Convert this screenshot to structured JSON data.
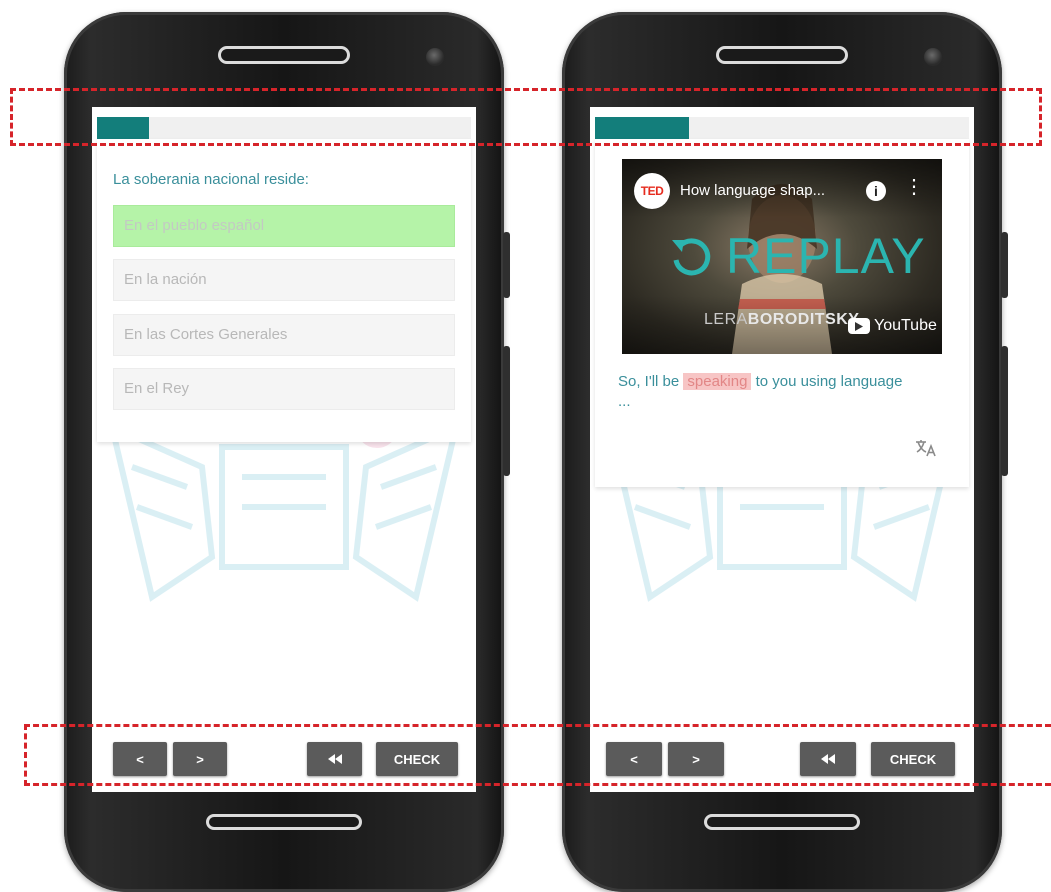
{
  "colors": {
    "progress": "#137e7b",
    "question_text": "#3a8f9b",
    "correct_option": "#b5f3a8",
    "button_bg": "#5b5b5b",
    "highlight_word": "#f7c5c5",
    "replay": "#2bb5b0",
    "dashed_box": "#d6242a"
  },
  "left_phone": {
    "progress": 0.14,
    "question": "La soberania nacional reside:",
    "options": [
      {
        "label": "En el pueblo español",
        "state": "correct"
      },
      {
        "label": "En la nación",
        "state": "default"
      },
      {
        "label": "En las Cortes Generales",
        "state": "default"
      },
      {
        "label": "En el Rey",
        "state": "default"
      }
    ],
    "buttons": {
      "prev": "<",
      "next": ">",
      "rewind_icon": "rewind-icon",
      "check": "CHECK"
    }
  },
  "right_phone": {
    "progress": 0.25,
    "video": {
      "channel_logo": "TED",
      "title": "How language shap...",
      "info_icon": "info-icon",
      "more_icon": "more-vertical-icon",
      "replay_label": "REPLAY",
      "speaker_first": "LERA",
      "speaker_last": "BORODITSKY",
      "platform": "YouTube"
    },
    "transcript": {
      "before": "So, I'll be",
      "highlight": "speaking",
      "after": "to you using language",
      "ellipsis": "..."
    },
    "translate_icon": "translate-icon",
    "buttons": {
      "prev": "<",
      "next": ">",
      "rewind_icon": "rewind-icon",
      "check": "CHECK"
    }
  }
}
